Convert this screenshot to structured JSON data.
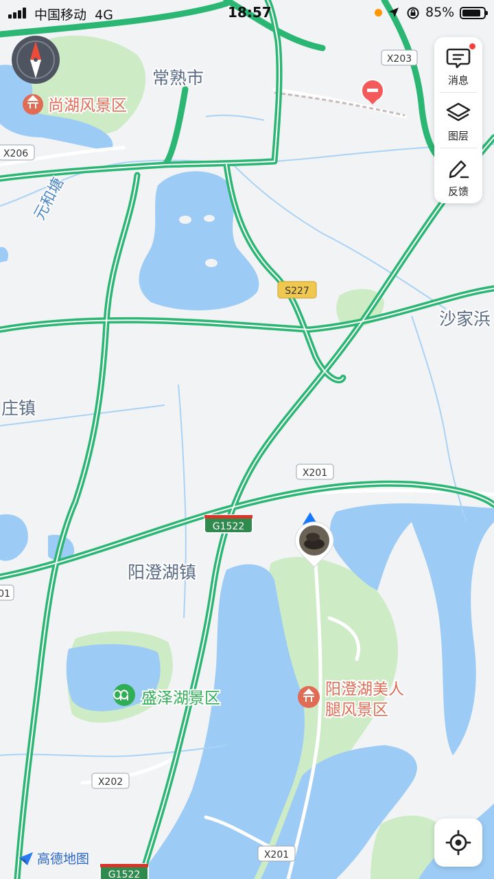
{
  "status_bar": {
    "carrier": "中国移动",
    "network": "4G",
    "time": "18:57",
    "battery": "85%"
  },
  "side_panel": {
    "messages_label": "消息",
    "layers_label": "图层",
    "feedback_label": "反馈"
  },
  "map": {
    "places": {
      "changshu": "常熟市",
      "shajiabang": "沙家浜",
      "zhuang_zhen": "庄镇",
      "yangchenghu_zhen": "阳澄湖镇",
      "wuhe_tang": "元和塘"
    },
    "pois": {
      "shanghu": "尚湖风景区",
      "shengze": "盛泽湖景区",
      "meirentui_line1": "阳澄湖美人",
      "meirentui_line2": "腿风景区"
    },
    "road_shields": {
      "x203": "X203",
      "x206": "X206",
      "s227": "S227",
      "x201_top": "X201",
      "g1522_mid": "G1522",
      "left_01": "01",
      "x202": "X202",
      "x201_bottom": "X201",
      "g1522_bottom": "G1522"
    },
    "colors": {
      "water": "#9ccbf5",
      "greenspace": "#cdebc5",
      "land": "#f1f3f5",
      "highway": "#2bb673",
      "poi_red": "#e06c55",
      "poi_green": "#2fae56",
      "place_text": "#5a6b85"
    }
  },
  "branding": {
    "logo_text": "高德地图"
  }
}
